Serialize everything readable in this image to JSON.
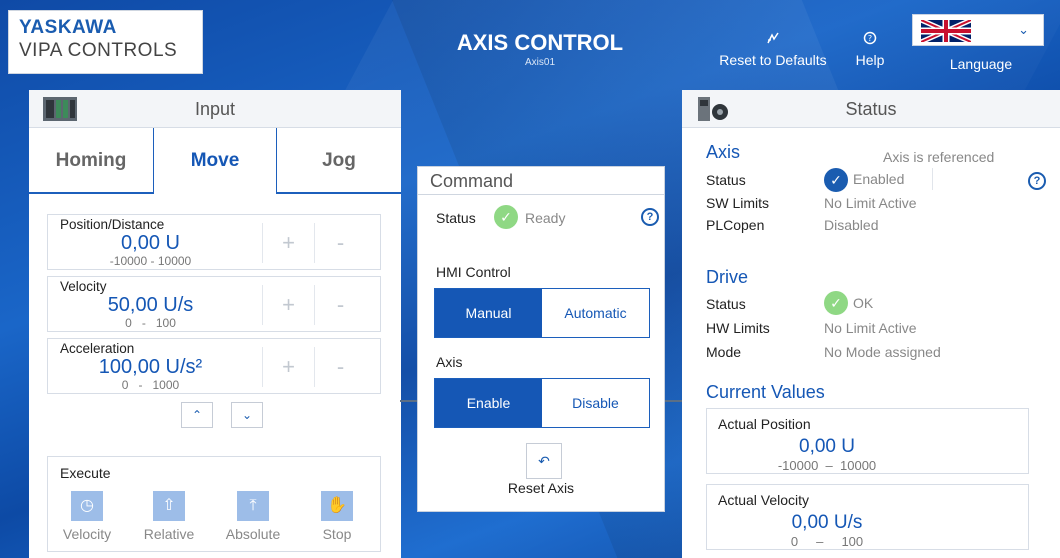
{
  "header": {
    "logo_line1": "YASKAWA",
    "logo_line2": "VIPA CONTROLS",
    "title": "AXIS CONTROL",
    "subtitle": "Axis01",
    "reset_defaults": "Reset to Defaults",
    "help": "Help",
    "language": "Language",
    "language_flag": "uk-flag-icon"
  },
  "input": {
    "title": "Input",
    "tabs": {
      "homing": "Homing",
      "move": "Move",
      "jog": "Jog",
      "active": "Move"
    },
    "position": {
      "label": "Position/Distance",
      "value": "0,00 U",
      "min": "-10000",
      "sep": "-",
      "max": "10000"
    },
    "velocity": {
      "label": "Velocity",
      "value": "50,00 U/s",
      "min": "0",
      "sep": "-",
      "max": "100"
    },
    "acceleration": {
      "label": "Acceleration",
      "value": "100,00 U/s²",
      "min": "0",
      "sep": "-",
      "max": "1000"
    },
    "plus": "+",
    "minus": "-",
    "execute": {
      "label": "Execute",
      "velocity": "Velocity",
      "relative": "Relative",
      "absolute": "Absolute",
      "stop": "Stop"
    }
  },
  "command": {
    "title": "Command",
    "status_label": "Status",
    "status_value": "Ready",
    "hmi_label": "HMI Control",
    "manual": "Manual",
    "automatic": "Automatic",
    "axis_label": "Axis",
    "enable": "Enable",
    "disable": "Disable",
    "reset_axis": "Reset Axis"
  },
  "status": {
    "title": "Status",
    "axis": {
      "title": "Axis",
      "note": "Axis is referenced",
      "status_k": "Status",
      "status_v": "Enabled",
      "sw_k": "SW Limits",
      "sw_v": "No Limit Active",
      "plc_k": "PLCopen",
      "plc_v": "Disabled"
    },
    "drive": {
      "title": "Drive",
      "status_k": "Status",
      "status_v": "OK",
      "hw_k": "HW Limits",
      "hw_v": "No Limit Active",
      "mode_k": "Mode",
      "mode_v": "No Mode assigned"
    },
    "current": {
      "title": "Current Values",
      "pos_label": "Actual Position",
      "pos_value": "0,00 U",
      "pos_min": "-10000",
      "pos_sep": "–",
      "pos_max": "10000",
      "vel_label": "Actual Velocity",
      "vel_value": "0,00 U/s",
      "vel_min": "0",
      "vel_sep": "–",
      "vel_max": "100"
    }
  },
  "colors": {
    "accent": "#1557b5",
    "ok_green": "#8fd884",
    "background": "#1258b8"
  }
}
